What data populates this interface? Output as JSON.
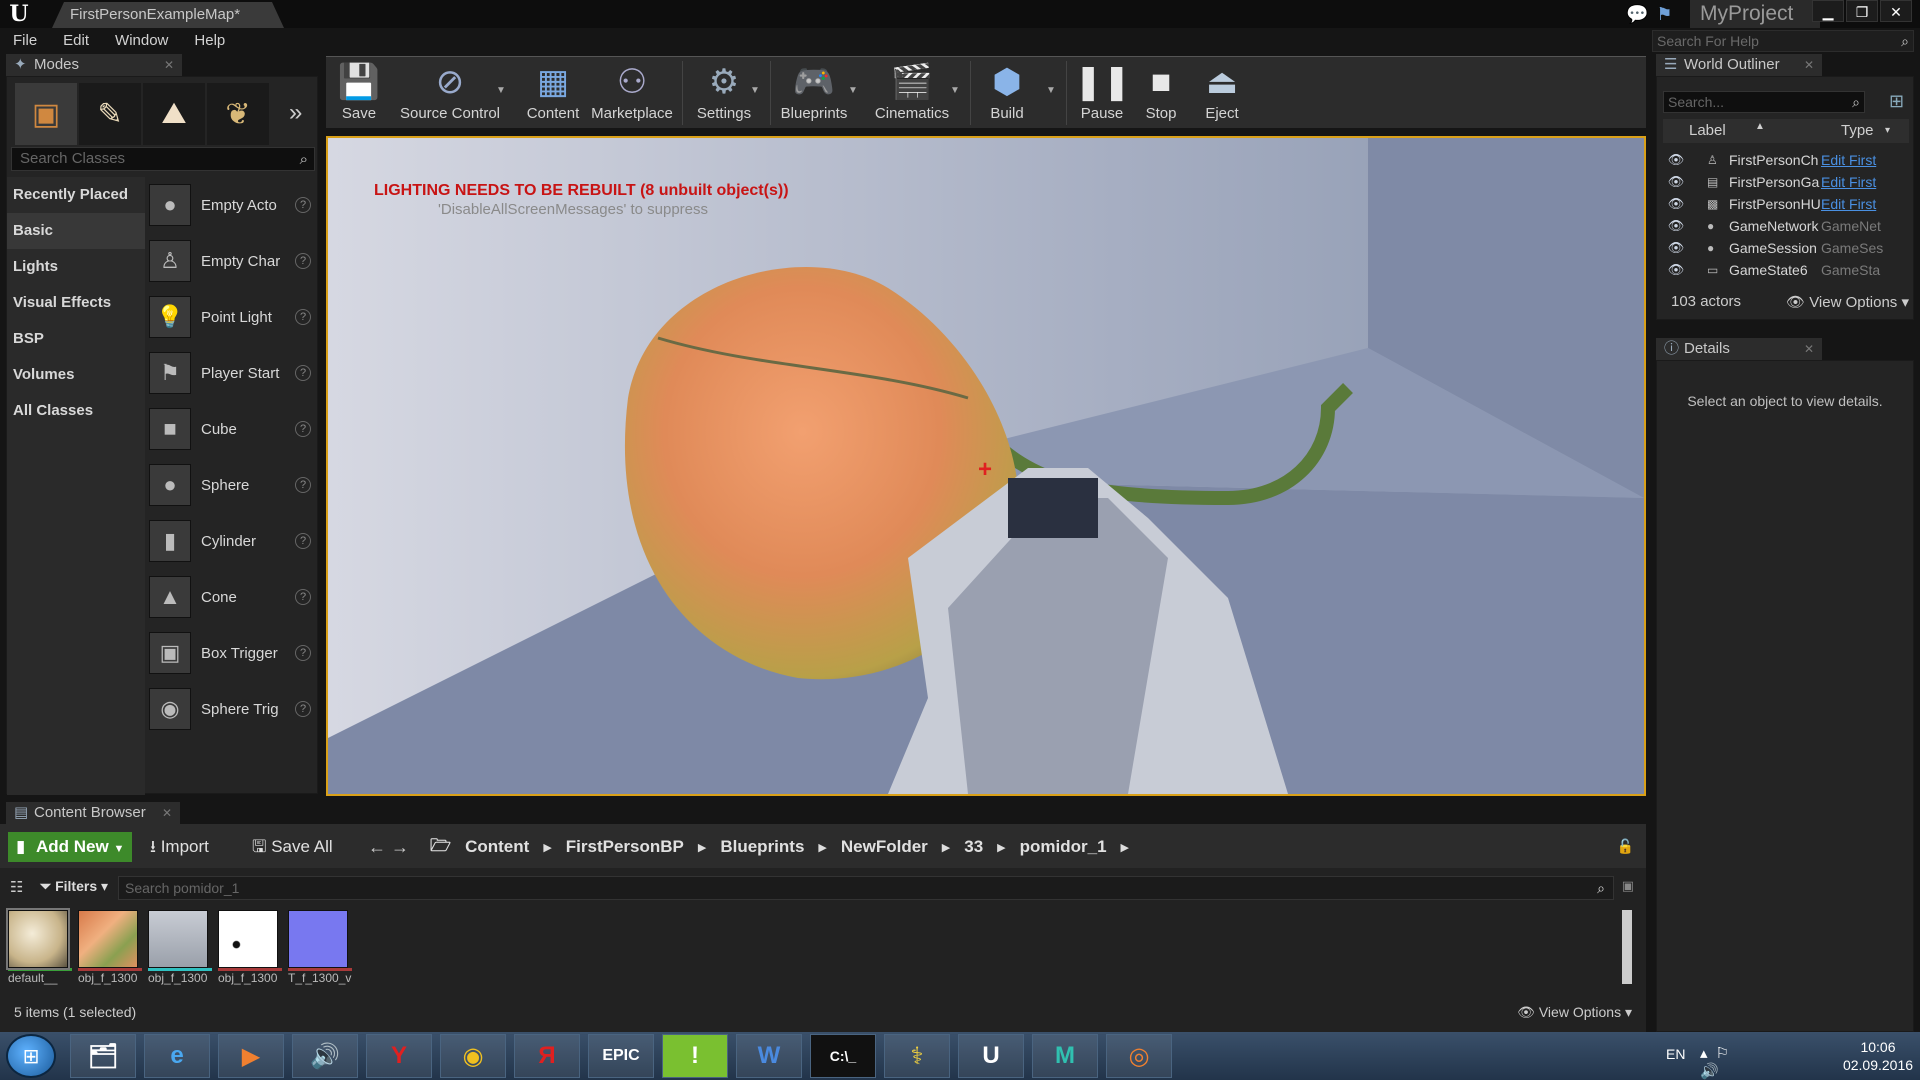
{
  "titlebar": {
    "map_tab": "FirstPersonExampleMap*",
    "project": "MyProject",
    "help_search_placeholder": "Search For Help"
  },
  "menu": [
    "File",
    "Edit",
    "Window",
    "Help"
  ],
  "modes": {
    "tab_label": "Modes",
    "search_placeholder": "Search Classes",
    "categories": [
      "Recently Placed",
      "Basic",
      "Lights",
      "Visual Effects",
      "BSP",
      "Volumes",
      "All Classes"
    ],
    "active_category": "Basic",
    "items": [
      {
        "label": "Empty Acto",
        "icon": "sphere-icon"
      },
      {
        "label": "Empty Char",
        "icon": "character-icon"
      },
      {
        "label": "Point Light",
        "icon": "light-bulb-icon"
      },
      {
        "label": "Player Start",
        "icon": "player-start-icon"
      },
      {
        "label": "Cube",
        "icon": "cube-icon"
      },
      {
        "label": "Sphere",
        "icon": "sphere-icon"
      },
      {
        "label": "Cylinder",
        "icon": "cylinder-icon"
      },
      {
        "label": "Cone",
        "icon": "cone-icon"
      },
      {
        "label": "Box Trigger",
        "icon": "box-trigger-icon"
      },
      {
        "label": "Sphere Trig",
        "icon": "sphere-trigger-icon"
      }
    ]
  },
  "toolbar": {
    "buttons": [
      {
        "label": "Save",
        "icon": "save-icon"
      },
      {
        "label": "Source Control",
        "icon": "source-control-icon"
      },
      {
        "label": "Content",
        "icon": "content-icon"
      },
      {
        "label": "Marketplace",
        "icon": "marketplace-icon"
      },
      {
        "label": "Settings",
        "icon": "settings-icon"
      },
      {
        "label": "Blueprints",
        "icon": "blueprints-icon"
      },
      {
        "label": "Cinematics",
        "icon": "cinematics-icon"
      },
      {
        "label": "Build",
        "icon": "build-icon"
      },
      {
        "label": "Pause",
        "icon": "pause-icon"
      },
      {
        "label": "Stop",
        "icon": "stop-icon"
      },
      {
        "label": "Eject",
        "icon": "eject-icon"
      }
    ]
  },
  "viewport": {
    "warning": "LIGHTING NEEDS TO BE REBUILT (8 unbuilt object(s))",
    "warning_sub": "'DisableAllScreenMessages' to suppress"
  },
  "outliner": {
    "tab_label": "World Outliner",
    "search_placeholder": "Search...",
    "col_label": "Label",
    "col_type": "Type",
    "rows": [
      {
        "label": "FirstPersonCh",
        "type": "Edit First",
        "link": true
      },
      {
        "label": "FirstPersonGa",
        "type": "Edit First",
        "link": true
      },
      {
        "label": "FirstPersonHU",
        "type": "Edit First",
        "link": true
      },
      {
        "label": "GameNetwork",
        "type": "GameNet",
        "link": false
      },
      {
        "label": "GameSession",
        "type": "GameSes",
        "link": false
      },
      {
        "label": "GameState6",
        "type": "GameSta",
        "link": false
      }
    ],
    "actor_count": "103 actors",
    "view_options": "View Options"
  },
  "details": {
    "tab_label": "Details",
    "message": "Select an object to view details."
  },
  "content_browser": {
    "tab_label": "Content Browser",
    "add_new": "Add New",
    "import": "Import",
    "save_all": "Save All",
    "breadcrumb": [
      "Content",
      "FirstPersonBP",
      "Blueprints",
      "NewFolder",
      "33",
      "pomidor_1"
    ],
    "filters": "Filters",
    "search_placeholder": "Search pomidor_1",
    "assets": [
      {
        "label": "default__",
        "bar_color": "#3aa03a",
        "selected": true
      },
      {
        "label": "obj_f_1300",
        "bar_color": "#a83a3a",
        "selected": false
      },
      {
        "label": "obj_f_1300",
        "bar_color": "#30c0c0",
        "selected": false
      },
      {
        "label": "obj_f_1300",
        "bar_color": "#a83a3a",
        "selected": false
      },
      {
        "label": "T_f_1300_v",
        "bar_color": "#a83a3a",
        "selected": false
      }
    ],
    "status": "5 items (1 selected)",
    "view_options": "View Options"
  },
  "taskbar": {
    "apps": [
      "explorer-icon",
      "internet-explorer-icon",
      "media-player-icon",
      "speaker-app-icon",
      "yandex-browser-icon",
      "chrome-icon",
      "yandex-icon",
      "epic-games-icon",
      "green-app-icon",
      "word-icon",
      "cmd-icon",
      "python-icon",
      "unreal-icon",
      "maya-icon",
      "blender-icon"
    ],
    "lang": "EN",
    "time": "10:06",
    "date": "02.09.2016"
  },
  "colors": {
    "viewport_highlight": "#d9a018",
    "add_new_green": "#3d8a2a",
    "warning_red": "#c81414",
    "link_blue": "#4a90e2"
  }
}
